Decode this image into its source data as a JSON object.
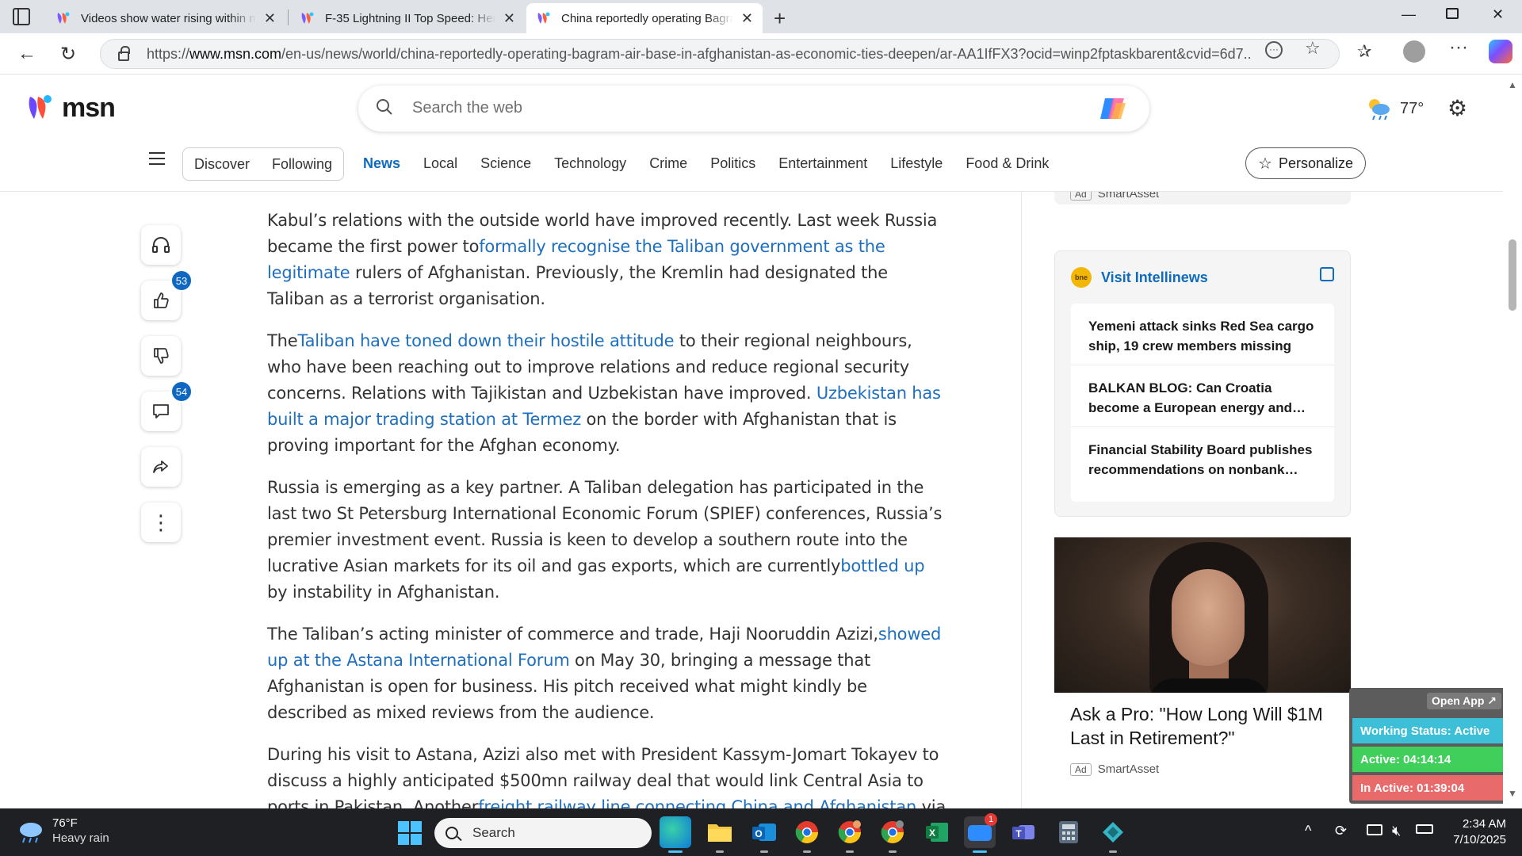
{
  "browser": {
    "tabs": [
      {
        "title": "Videos show water rising within m",
        "active": false
      },
      {
        "title": "F-35 Lightning II Top Speed: Here",
        "active": false
      },
      {
        "title": "China reportedly operating Bagra",
        "active": true
      }
    ],
    "url_prefix": "https://",
    "url_domain": "www.msn.com",
    "url_path": "/en-us/news/world/china-reportedly-operating-bagram-air-base-in-afghanistan-as-economic-ties-deepen/ar-AA1IfFX3?ocid=winp2fptaskbarent&cvid=6d7..."
  },
  "msn": {
    "logo_text": "msn",
    "search_placeholder": "Search the web",
    "weather_temp": "77°",
    "pills": [
      "Discover",
      "Following"
    ],
    "nav": [
      "News",
      "Local",
      "Science",
      "Technology",
      "Crime",
      "Politics",
      "Entertainment",
      "Lifestyle",
      "Food & Drink"
    ],
    "active_nav": "News",
    "personalize_label": "Personalize"
  },
  "rail": {
    "likes_count": "53",
    "comments_count": "54",
    "icons": [
      "headphones-icon",
      "thumbs-up-icon",
      "thumbs-down-icon",
      "comment-icon",
      "share-icon",
      "more-icon"
    ]
  },
  "article": {
    "p1": {
      "t1": "Kabul’s relations with the outside world have improved recently. Last week Russia became the first power to",
      "link1": "formally recognise the Taliban government as the legitimate",
      "t2": " rulers of Afghanistan. Previously, the Kremlin had designated the Taliban as a terrorist organisation."
    },
    "p2": {
      "t1": "The",
      "link1": "Taliban have toned down their hostile attitude",
      "t2": " to their regional neighbours, who have been reaching out to improve relations and reduce regional security concerns. Relations with Tajikistan and Uzbekistan have improved. ",
      "link2": "Uzbekistan has built a major trading station at Termez",
      "t3": " on the border with Afghanistan that is proving important for the Afghan economy."
    },
    "p3": {
      "t1": "Russia is emerging as a key partner. A Taliban delegation has participated in the last two St Petersburg International Economic Forum (SPIEF) conferences, Russia’s premier investment event. Russia is keen to develop a southern route into the lucrative Asian markets for its oil and gas exports, which are currently",
      "link1": "bottled up",
      "t2": " by instability in Afghanistan."
    },
    "p4": {
      "t1": "The Taliban’s acting minister of commerce and trade, Haji Nooruddin Azizi,",
      "link1": "showed up at the Astana International Forum",
      "t2": " on May 30, bringing a message that Afghanistan is open for business. His pitch received what might kindly be described as mixed reviews from the audience."
    },
    "p5": {
      "t1": "During his visit to Astana, Azizi also met with President Kassym-Jomart Tokayev to discuss a highly anticipated $500mn railway deal that would link Central Asia to ports in Pakistan. Another",
      "link1": "freight railway line connecting China and Afghanistan",
      "t2": " via Tajikistan and Uzbekistan is already in operation."
    }
  },
  "sidebar": {
    "top_ad": {
      "tag": "Ad",
      "source": "SmartAsset"
    },
    "intellinews": {
      "badge": "bne",
      "title": "Visit Intellinews",
      "items": [
        "Yemeni attack sinks Red Sea cargo ship, 19 crew members missing",
        "BALKAN BLOG: Can Croatia become a European energy and…",
        "Financial Stability Board publishes recommendations on nonbank…"
      ]
    },
    "promo": {
      "title": "Ask a Pro: \"How Long Will $1M Last in Retirement?\"",
      "tag": "Ad",
      "source": "SmartAsset"
    }
  },
  "status_widget": {
    "open_app": "Open App ↗",
    "working": "Working Status: Active",
    "active": "Active: 04:14:14",
    "inactive": "In Active: 01:39:04",
    "colors": {
      "working": "#3dbfd8",
      "active": "#3fcf5a",
      "inactive": "#e86a6a"
    }
  },
  "taskbar": {
    "weather_temp": "76°F",
    "weather_desc": "Heavy rain",
    "search_label": "Search",
    "time": "2:34 AM",
    "date": "7/10/2025",
    "apps": [
      "edge-icon",
      "file-explorer-icon",
      "outlook-icon",
      "chrome-icon",
      "chrome-profile-icon",
      "chrome-alt-icon",
      "excel-icon",
      "zoom-icon",
      "teams-icon",
      "calculator-icon",
      "vpn-icon"
    ],
    "zoom_badge": "1"
  },
  "colors": {
    "accent": "#0f6cbd",
    "link": "#1f6fbf",
    "taskbar": "#1f2023"
  }
}
